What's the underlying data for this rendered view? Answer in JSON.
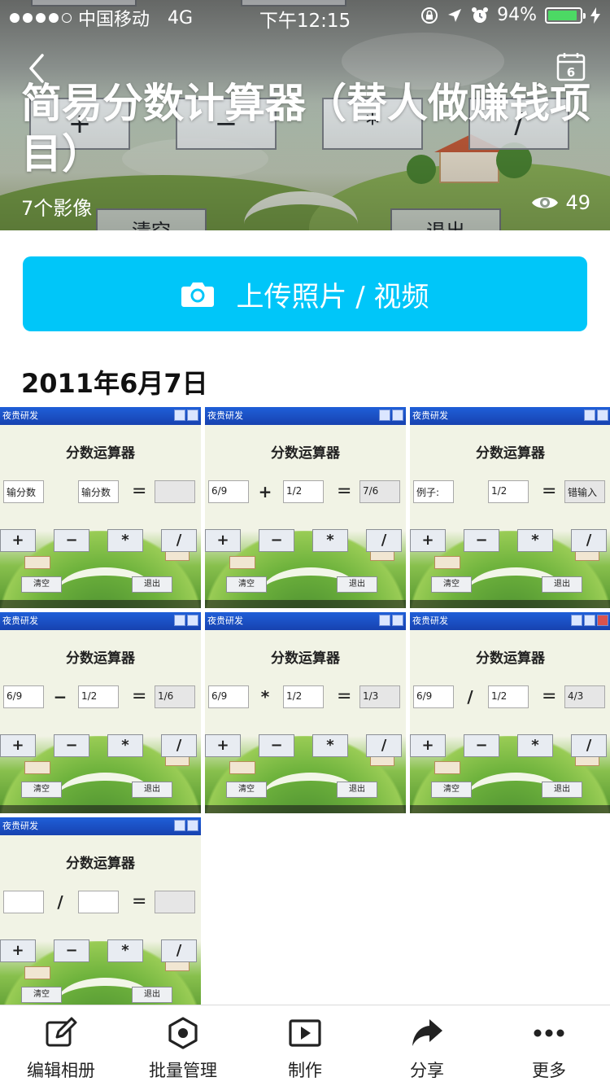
{
  "status_bar": {
    "carrier": "中国移动",
    "network": "4G",
    "time": "下午12:15",
    "battery": "94%",
    "battery_level": 0.94
  },
  "album": {
    "title": "简易分数计算器（替人做赚钱项目）",
    "item_count": "7个影像",
    "views": "49",
    "calendar_badge": "6",
    "cover_buttons": [
      "+",
      "−",
      "*",
      "/",
      "清空",
      "退出"
    ]
  },
  "upload": {
    "label": "上传照片 / 视频"
  },
  "date_section": {
    "heading": "2011年6月7日"
  },
  "photos": [
    {
      "window_title": "夜贵研发",
      "heading": "分数运算器",
      "left": "输分数",
      "op": "",
      "right": "输分数",
      "eq": "=",
      "result": "",
      "keys": [
        "+",
        "−",
        "*",
        "/"
      ],
      "clear": "清空",
      "exit": "退出"
    },
    {
      "window_title": "夜贵研发",
      "heading": "分数运算器",
      "left": "6/9",
      "op": "+",
      "right": "1/2",
      "eq": "=",
      "result": "7/6",
      "keys": [
        "+",
        "−",
        "*",
        "/"
      ],
      "clear": "清空",
      "exit": "退出"
    },
    {
      "window_title": "夜贵研发",
      "heading": "分数运算器",
      "left": "例子:",
      "op": "",
      "right": "1/2",
      "eq": "=",
      "result": "错输入",
      "keys": [
        "+",
        "−",
        "*",
        "/"
      ],
      "clear": "清空",
      "exit": "退出"
    },
    {
      "window_title": "夜贵研发",
      "heading": "分数运算器",
      "left": "6/9",
      "op": "−",
      "right": "1/2",
      "eq": "=",
      "result": "1/6",
      "keys": [
        "+",
        "−",
        "*",
        "/"
      ],
      "clear": "清空",
      "exit": "退出"
    },
    {
      "window_title": "夜贵研发",
      "heading": "分数运算器",
      "left": "6/9",
      "op": "*",
      "right": "1/2",
      "eq": "=",
      "result": "1/3",
      "keys": [
        "+",
        "−",
        "*",
        "/"
      ],
      "clear": "清空",
      "exit": "退出"
    },
    {
      "window_title": "夜贵研发",
      "heading": "分数运算器",
      "left": "6/9",
      "op": "/",
      "right": "1/2",
      "eq": "=",
      "result": "4/3",
      "keys": [
        "+",
        "−",
        "*",
        "/"
      ],
      "clear": "清空",
      "exit": "退出"
    },
    {
      "window_title": "夜贵研发",
      "heading": "分数运算器",
      "left": "",
      "op": "/",
      "right": "",
      "eq": "=",
      "result": "",
      "keys": [
        "+",
        "−",
        "*",
        "/"
      ],
      "clear": "清空",
      "exit": "退出"
    }
  ],
  "tabbar": {
    "items": [
      {
        "label": "编辑相册",
        "icon": "edit-icon"
      },
      {
        "label": "批量管理",
        "icon": "hexagon-icon"
      },
      {
        "label": "制作",
        "icon": "play-icon"
      },
      {
        "label": "分享",
        "icon": "share-icon"
      },
      {
        "label": "更多",
        "icon": "more-icon"
      }
    ]
  },
  "colors": {
    "accent": "#00c6f9",
    "battery": "#4cd964"
  }
}
